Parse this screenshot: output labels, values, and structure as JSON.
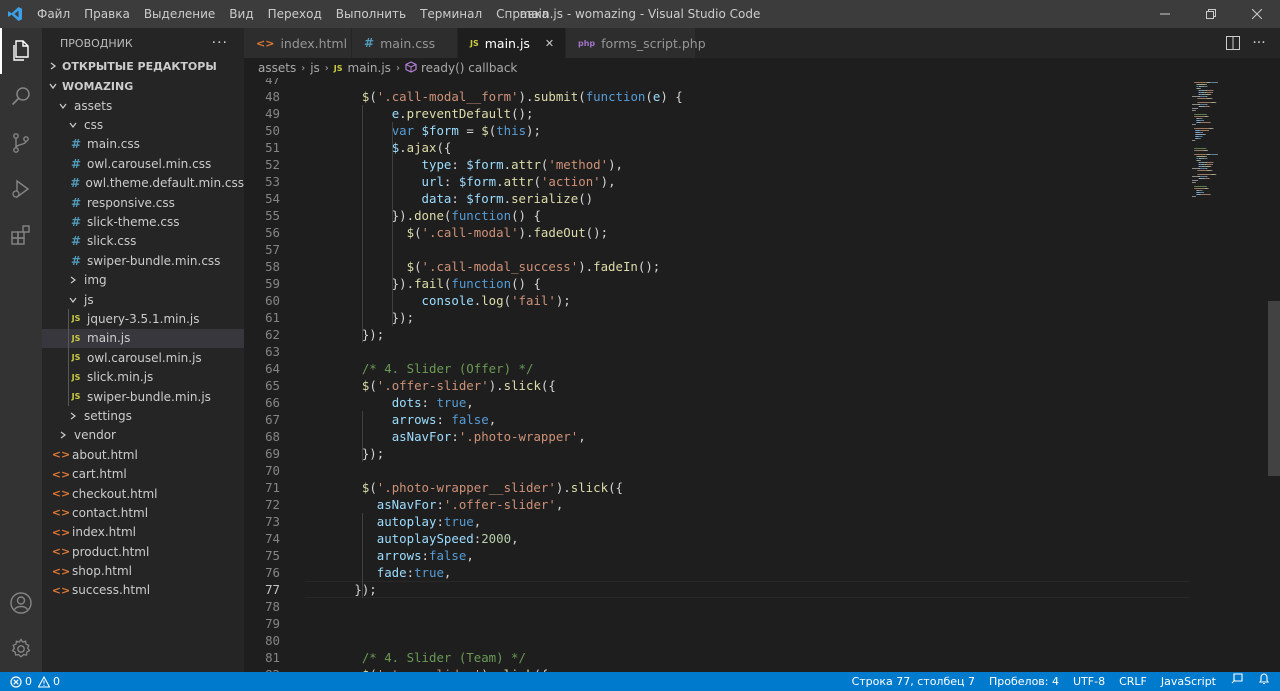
{
  "app": {
    "window_title": "main.js - womazing - Visual Studio Code"
  },
  "menu": [
    "Файл",
    "Правка",
    "Выделение",
    "Вид",
    "Переход",
    "Выполнить",
    "Терминал",
    "Справка"
  ],
  "sidebar": {
    "title": "ПРОВОДНИК",
    "open_editors": "ОТКРЫТЫЕ РЕДАКТОРЫ",
    "project": "WOMAZING",
    "tree": [
      {
        "label": "assets",
        "type": "folder",
        "depth": 1,
        "open": true
      },
      {
        "label": "css",
        "type": "folder",
        "depth": 2,
        "open": true
      },
      {
        "label": "main.css",
        "type": "css",
        "depth": 3
      },
      {
        "label": "owl.carousel.min.css",
        "type": "css",
        "depth": 3
      },
      {
        "label": "owl.theme.default.min.css",
        "type": "css",
        "depth": 3
      },
      {
        "label": "responsive.css",
        "type": "css",
        "depth": 3
      },
      {
        "label": "slick-theme.css",
        "type": "css",
        "depth": 3
      },
      {
        "label": "slick.css",
        "type": "css",
        "depth": 3
      },
      {
        "label": "swiper-bundle.min.css",
        "type": "css",
        "depth": 3
      },
      {
        "label": "img",
        "type": "folder",
        "depth": 2,
        "open": false
      },
      {
        "label": "js",
        "type": "folder",
        "depth": 2,
        "open": true
      },
      {
        "label": "jquery-3.5.1.min.js",
        "type": "js",
        "depth": 3
      },
      {
        "label": "main.js",
        "type": "js",
        "depth": 3,
        "selected": true
      },
      {
        "label": "owl.carousel.min.js",
        "type": "js",
        "depth": 3
      },
      {
        "label": "slick.min.js",
        "type": "js",
        "depth": 3
      },
      {
        "label": "swiper-bundle.min.js",
        "type": "js",
        "depth": 3
      },
      {
        "label": "settings",
        "type": "folder",
        "depth": 2,
        "open": false
      },
      {
        "label": "vendor",
        "type": "folder",
        "depth": 1,
        "open": false
      },
      {
        "label": "about.html",
        "type": "html",
        "depth": 1
      },
      {
        "label": "cart.html",
        "type": "html",
        "depth": 1
      },
      {
        "label": "checkout.html",
        "type": "html",
        "depth": 1
      },
      {
        "label": "contact.html",
        "type": "html",
        "depth": 1
      },
      {
        "label": "index.html",
        "type": "html",
        "depth": 1
      },
      {
        "label": "product.html",
        "type": "html",
        "depth": 1
      },
      {
        "label": "shop.html",
        "type": "html",
        "depth": 1
      },
      {
        "label": "success.html",
        "type": "html",
        "depth": 1
      }
    ]
  },
  "tabs": [
    {
      "label": "index.html",
      "icon": "html-file-icon",
      "active": false
    },
    {
      "label": "main.css",
      "icon": "css-file-icon",
      "active": false
    },
    {
      "label": "main.js",
      "icon": "js-file-icon",
      "active": true
    },
    {
      "label": "forms_script.php",
      "icon": "php-file-icon",
      "active": false
    }
  ],
  "breadcrumb": [
    "assets",
    "js",
    "main.js",
    "ready() callback"
  ],
  "editor": {
    "first_visible_line": 47,
    "current_line": 77,
    "lines": [
      [
        [
          "p",
          ""
        ]
      ],
      [
        [
          "p",
          "    "
        ],
        [
          "fn",
          "$"
        ],
        [
          "p",
          "("
        ],
        [
          "str",
          "'.call-modal__form'"
        ],
        [
          "p",
          ")."
        ],
        [
          "fn",
          "submit"
        ],
        [
          "p",
          "("
        ],
        [
          "kw",
          "function"
        ],
        [
          "p",
          "("
        ],
        [
          "var",
          "e"
        ],
        [
          "p",
          ") {"
        ]
      ],
      [
        [
          "p",
          "        "
        ],
        [
          "var",
          "e"
        ],
        [
          "p",
          "."
        ],
        [
          "fn",
          "preventDefault"
        ],
        [
          "p",
          "();"
        ]
      ],
      [
        [
          "p",
          "        "
        ],
        [
          "kw",
          "var"
        ],
        [
          "p",
          " "
        ],
        [
          "var",
          "$form"
        ],
        [
          "p",
          " = "
        ],
        [
          "fn",
          "$"
        ],
        [
          "p",
          "("
        ],
        [
          "kw",
          "this"
        ],
        [
          "p",
          ");"
        ]
      ],
      [
        [
          "p",
          "        "
        ],
        [
          "var",
          "$"
        ],
        [
          "p",
          "."
        ],
        [
          "fn",
          "ajax"
        ],
        [
          "p",
          "({"
        ]
      ],
      [
        [
          "p",
          "            "
        ],
        [
          "var",
          "type"
        ],
        [
          "p",
          ": "
        ],
        [
          "var",
          "$form"
        ],
        [
          "p",
          "."
        ],
        [
          "fn",
          "attr"
        ],
        [
          "p",
          "("
        ],
        [
          "str",
          "'method'"
        ],
        [
          "p",
          "),"
        ]
      ],
      [
        [
          "p",
          "            "
        ],
        [
          "var",
          "url"
        ],
        [
          "p",
          ": "
        ],
        [
          "var",
          "$form"
        ],
        [
          "p",
          "."
        ],
        [
          "fn",
          "attr"
        ],
        [
          "p",
          "("
        ],
        [
          "str",
          "'action'"
        ],
        [
          "p",
          "),"
        ]
      ],
      [
        [
          "p",
          "            "
        ],
        [
          "var",
          "data"
        ],
        [
          "p",
          ": "
        ],
        [
          "var",
          "$form"
        ],
        [
          "p",
          "."
        ],
        [
          "fn",
          "serialize"
        ],
        [
          "p",
          "()"
        ]
      ],
      [
        [
          "p",
          "        })."
        ],
        [
          "fn",
          "done"
        ],
        [
          "p",
          "("
        ],
        [
          "kw",
          "function"
        ],
        [
          "p",
          "() {"
        ]
      ],
      [
        [
          "p",
          "          "
        ],
        [
          "fn",
          "$"
        ],
        [
          "p",
          "("
        ],
        [
          "str",
          "'.call-modal'"
        ],
        [
          "p",
          ")."
        ],
        [
          "fn",
          "fadeOut"
        ],
        [
          "p",
          "();"
        ]
      ],
      [
        [
          "p",
          ""
        ]
      ],
      [
        [
          "p",
          "          "
        ],
        [
          "fn",
          "$"
        ],
        [
          "p",
          "("
        ],
        [
          "str",
          "'.call-modal_success'"
        ],
        [
          "p",
          ")."
        ],
        [
          "fn",
          "fadeIn"
        ],
        [
          "p",
          "();"
        ]
      ],
      [
        [
          "p",
          "        })."
        ],
        [
          "fn",
          "fail"
        ],
        [
          "p",
          "("
        ],
        [
          "kw",
          "function"
        ],
        [
          "p",
          "() {"
        ]
      ],
      [
        [
          "p",
          "            "
        ],
        [
          "var",
          "console"
        ],
        [
          "p",
          "."
        ],
        [
          "fn",
          "log"
        ],
        [
          "p",
          "("
        ],
        [
          "str",
          "'fail'"
        ],
        [
          "p",
          ");"
        ]
      ],
      [
        [
          "p",
          "        });"
        ]
      ],
      [
        [
          "p",
          "    });"
        ]
      ],
      [
        [
          "p",
          ""
        ]
      ],
      [
        [
          "p",
          "    "
        ],
        [
          "cm",
          "/* 4. Slider (Offer) */"
        ]
      ],
      [
        [
          "p",
          "    "
        ],
        [
          "fn",
          "$"
        ],
        [
          "p",
          "("
        ],
        [
          "str",
          "'.offer-slider'"
        ],
        [
          "p",
          ")."
        ],
        [
          "fn",
          "slick"
        ],
        [
          "p",
          "({"
        ]
      ],
      [
        [
          "p",
          "        "
        ],
        [
          "var",
          "dots"
        ],
        [
          "p",
          ": "
        ],
        [
          "kw",
          "true"
        ],
        [
          "p",
          ","
        ]
      ],
      [
        [
          "p",
          "        "
        ],
        [
          "var",
          "arrows"
        ],
        [
          "p",
          ": "
        ],
        [
          "kw",
          "false"
        ],
        [
          "p",
          ","
        ]
      ],
      [
        [
          "p",
          "        "
        ],
        [
          "var",
          "asNavFor"
        ],
        [
          "p",
          ":"
        ],
        [
          "str",
          "'.photo-wrapper'"
        ],
        [
          "p",
          ","
        ]
      ],
      [
        [
          "p",
          "    });"
        ]
      ],
      [
        [
          "p",
          ""
        ]
      ],
      [
        [
          "p",
          "    "
        ],
        [
          "fn",
          "$"
        ],
        [
          "p",
          "("
        ],
        [
          "str",
          "'.photo-wrapper__slider'"
        ],
        [
          "p",
          ")."
        ],
        [
          "fn",
          "slick"
        ],
        [
          "p",
          "({"
        ]
      ],
      [
        [
          "p",
          "      "
        ],
        [
          "var",
          "asNavFor"
        ],
        [
          "p",
          ":"
        ],
        [
          "str",
          "'.offer-slider'"
        ],
        [
          "p",
          ","
        ]
      ],
      [
        [
          "p",
          "      "
        ],
        [
          "var",
          "autoplay"
        ],
        [
          "p",
          ":"
        ],
        [
          "kw",
          "true"
        ],
        [
          "p",
          ","
        ]
      ],
      [
        [
          "p",
          "      "
        ],
        [
          "var",
          "autoplaySpeed"
        ],
        [
          "p",
          ":"
        ],
        [
          "num",
          "2000"
        ],
        [
          "p",
          ","
        ]
      ],
      [
        [
          "p",
          "      "
        ],
        [
          "var",
          "arrows"
        ],
        [
          "p",
          ":"
        ],
        [
          "kw",
          "false"
        ],
        [
          "p",
          ","
        ]
      ],
      [
        [
          "p",
          "      "
        ],
        [
          "var",
          "fade"
        ],
        [
          "p",
          ":"
        ],
        [
          "kw",
          "true"
        ],
        [
          "p",
          ","
        ]
      ],
      [
        [
          "p",
          "   });"
        ]
      ],
      [
        [
          "p",
          ""
        ]
      ],
      [
        [
          "p",
          ""
        ]
      ],
      [
        [
          "p",
          ""
        ]
      ],
      [
        [
          "p",
          "    "
        ],
        [
          "cm",
          "/* 4. Slider (Team) */"
        ]
      ],
      [
        [
          "p",
          "    "
        ],
        [
          "fn",
          "$"
        ],
        [
          "p",
          "("
        ],
        [
          "str",
          "'.team-slider'"
        ],
        [
          "p",
          ")."
        ],
        [
          "fn",
          "slick"
        ],
        [
          "p",
          "({"
        ]
      ]
    ]
  },
  "statusbar": {
    "errors": "0",
    "warnings": "0",
    "position": "Строка 77, столбец 7",
    "spaces": "Пробелов: 4",
    "encoding": "UTF-8",
    "eol": "CRLF",
    "language": "JavaScript"
  },
  "colors": {
    "accent": "#007acc",
    "activity_bar": "#333333",
    "sidebar": "#252526",
    "editor": "#1e1e1e"
  }
}
